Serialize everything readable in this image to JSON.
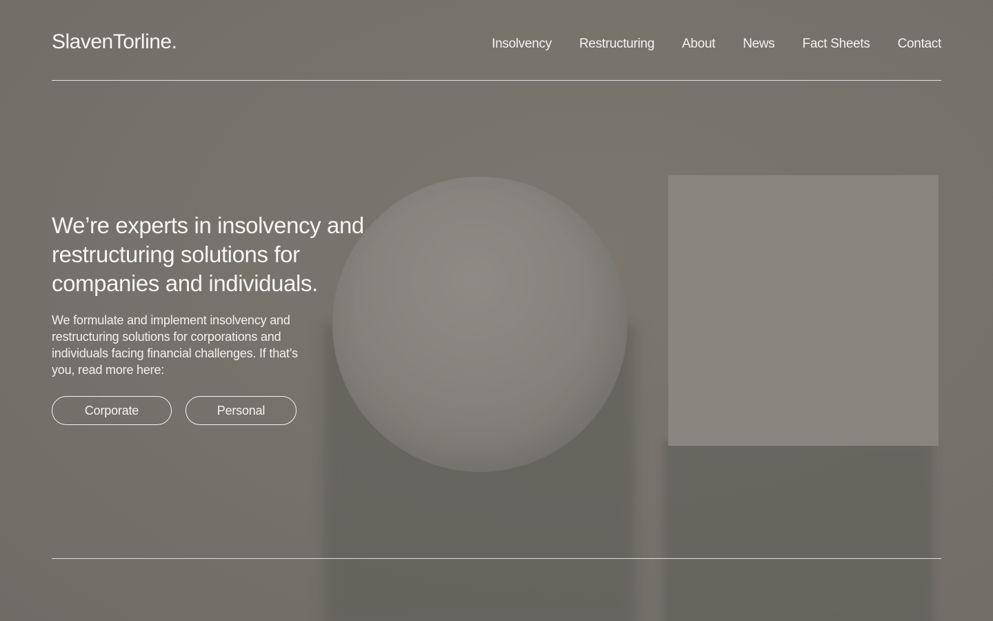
{
  "brand": {
    "logo_text": "SlavenTorline."
  },
  "nav": {
    "items": [
      {
        "label": "Insolvency"
      },
      {
        "label": "Restructuring"
      },
      {
        "label": "About"
      },
      {
        "label": "News"
      },
      {
        "label": "Fact Sheets"
      },
      {
        "label": "Contact"
      }
    ]
  },
  "hero": {
    "headline": "We’re experts in insolvency and restructuring solutions for companies and individuals.",
    "body": "We formulate and implement insolvency and restructuring solutions for corporations and individuals facing financial challenges. If that’s you, read more here:",
    "buttons": {
      "corporate_label": "Corporate",
      "personal_label": "Personal"
    }
  },
  "colors": {
    "background": "#75736b",
    "sphere": "#86847d",
    "square": "#88867e",
    "text": "#f3f2ee"
  }
}
